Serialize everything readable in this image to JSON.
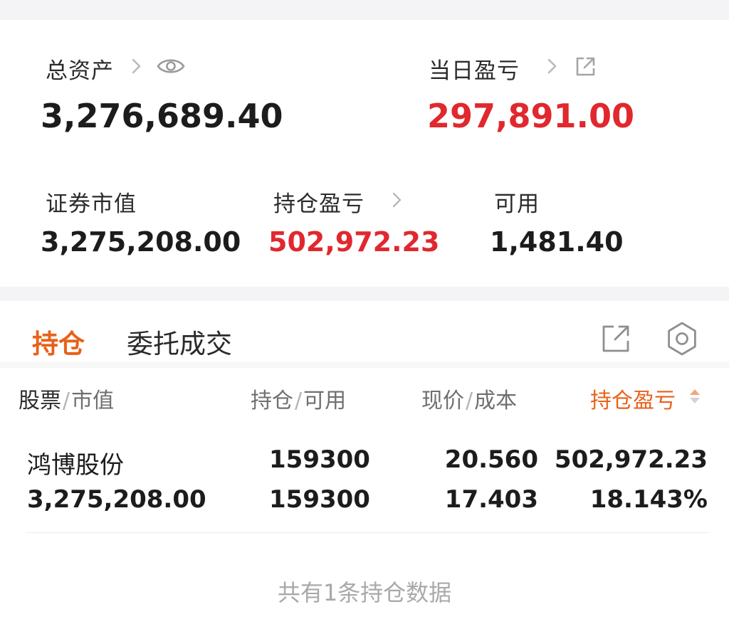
{
  "summary": {
    "total_assets_label": "总资产",
    "total_assets_value": "3,276,689.40",
    "daily_pnl_label": "当日盈亏",
    "daily_pnl_value": "297,891.00",
    "market_value_label": "证券市值",
    "market_value_value": "3,275,208.00",
    "position_pnl_label": "持仓盈亏",
    "position_pnl_value": "502,972.23",
    "available_label": "可用",
    "available_value": "1,481.40"
  },
  "tabs": {
    "positions": "持仓",
    "orders": "委托成交"
  },
  "table": {
    "col1_a": "股票",
    "col1_b": "市值",
    "col2_a": "持仓",
    "col2_b": "可用",
    "col3_a": "现价",
    "col3_b": "成本",
    "col4": "持仓盈亏",
    "rows": [
      {
        "name": "鸿博股份",
        "market_value": "3,275,208.00",
        "position": "159300",
        "available": "159300",
        "price": "20.560",
        "cost": "17.403",
        "pnl": "502,972.23",
        "pnl_pct": "18.143%"
      }
    ]
  },
  "footer_text": "共有1条持仓数据",
  "colors": {
    "accent": "#e8611a",
    "gain": "#e0282e",
    "separator": "#f4f4f6"
  },
  "icons": [
    "chevron-right-icon",
    "eye-icon",
    "external-link-icon",
    "share-icon",
    "gear-icon",
    "sort-icon"
  ]
}
